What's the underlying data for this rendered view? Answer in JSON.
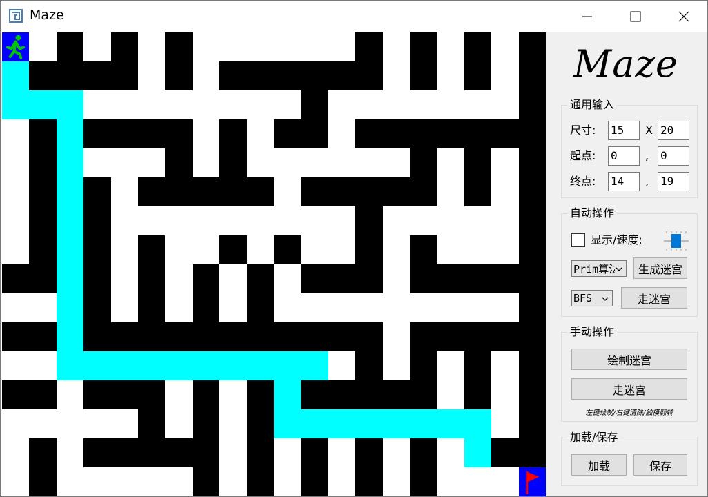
{
  "window": {
    "title": "Maze"
  },
  "titlebar": {
    "minimize_icon": "minimize-icon",
    "maximize_icon": "maximize-icon",
    "close_icon": "close-icon"
  },
  "maze": {
    "rows": 15,
    "cols": 20,
    "colors": {
      "wall": "#000000",
      "path": "#ffffff",
      "solution": "#00ffff",
      "start": "#0000ff",
      "end": "#0000ff",
      "runner": "#00c800",
      "flag": "#ff0000"
    },
    "start_icon": "running-person-icon",
    "end_icon": "red-flag-icon",
    "grid": [
      "SPWPWPWPPPPPPWPWPWPW",
      "CWWWWPWPWWWWWWPWPWPW",
      "CCCPPPPPPPPWPPPPPPPW",
      "PWCWWWWPWPWWPWWWWWWW",
      "PWCPPPWPWPPPPPPWPWPW",
      "PWCWPWWWWWPWWWWWPWPW",
      "PWCWPPPPPPPPPWPPPPPW",
      "PWCWPWPPWPWPPWPWPPPW",
      "WWCWPWPWPWPWWWPWWWWW",
      "PPCWPWPWPWPPPPPPPPPW",
      "WWCWWWWWWWWWWWPWWWWW",
      "PPCCCCCCCCCCPWPWPWPW",
      "WWPWWWPWPWCWWWWWPWPW",
      "PPPPPWPWPWCCCCCCCCPW",
      "PWPWWWWWPWPWPWPWPCWW",
      "PWPPPPPWPWPWPWPWPPPE"
    ]
  },
  "panel": {
    "logo": "Maze",
    "general": {
      "title": "通用输入",
      "size_label": "尺寸:",
      "size_w": "15",
      "size_x": "X",
      "size_h": "20",
      "start_label": "起点:",
      "start_r": "0",
      "start_sep": ",",
      "start_c": "0",
      "end_label": "终点:",
      "end_r": "14",
      "end_sep": ",",
      "end_c": "19"
    },
    "auto": {
      "title": "自动操作",
      "show_speed_label": "显示/速度:",
      "show_checked": false,
      "speed_level": 0.5,
      "gen_algo": "Prim算法",
      "gen_button": "生成迷宫",
      "solve_algo": "BFS",
      "solve_button": "走迷宫"
    },
    "manual": {
      "title": "手动操作",
      "draw_button": "绘制迷宫",
      "walk_button": "走迷宫",
      "hint": "左键绘制/右键清除/触摸翻转"
    },
    "io": {
      "title": "加载/保存",
      "load_button": "加载",
      "save_button": "保存"
    }
  }
}
